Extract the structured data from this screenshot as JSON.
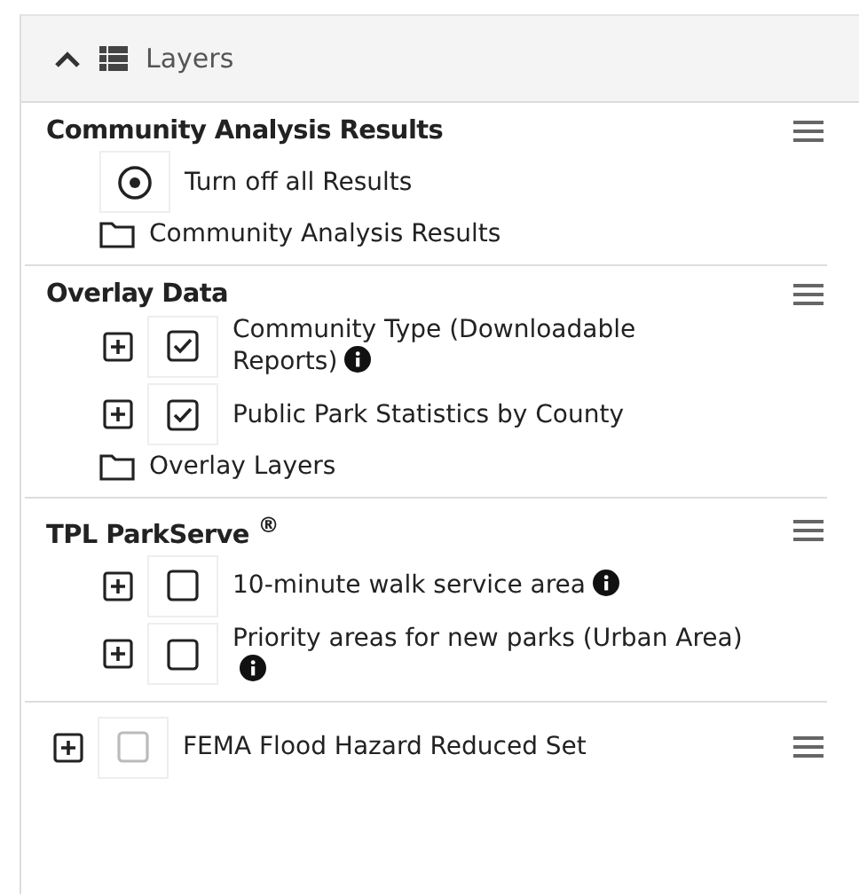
{
  "header": {
    "title": "Layers",
    "expanded": true
  },
  "sections": [
    {
      "kind": "group",
      "title": "Community Analysis Results",
      "items": [
        {
          "kind": "radio",
          "label": "Turn off all Results",
          "checked": true,
          "expandable": false,
          "info": false
        },
        {
          "kind": "folder",
          "label": "Community Analysis Results"
        }
      ]
    },
    {
      "kind": "group",
      "title": "Overlay Data",
      "items": [
        {
          "kind": "checkbox",
          "label": "Community Type (Downloadable Reports)",
          "checked": true,
          "expandable": true,
          "info": true
        },
        {
          "kind": "checkbox",
          "label": "Public Park Statistics by County",
          "checked": true,
          "expandable": true,
          "info": false
        },
        {
          "kind": "folder",
          "label": "Overlay Layers"
        }
      ]
    },
    {
      "kind": "group",
      "title": "TPL ParkServe $^{®}$",
      "items": [
        {
          "kind": "checkbox",
          "label": "10-minute walk service area",
          "checked": false,
          "expandable": true,
          "info": true
        },
        {
          "kind": "checkbox",
          "label": "Priority areas for new parks (Urban Area)",
          "checked": false,
          "expandable": true,
          "info": true
        }
      ]
    },
    {
      "kind": "layer",
      "label": "FEMA Flood Hazard Reduced Set",
      "checked": false,
      "disabled": true,
      "expandable": true
    }
  ]
}
